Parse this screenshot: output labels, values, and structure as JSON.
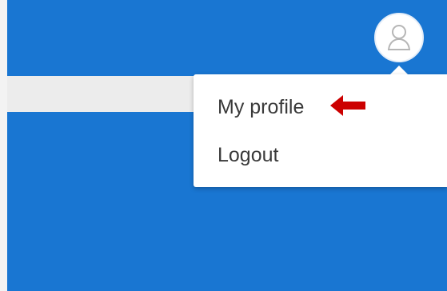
{
  "header": {
    "avatar_icon": "user-avatar-icon"
  },
  "user_menu": {
    "items": [
      {
        "label": "My profile",
        "icon": ""
      },
      {
        "label": "Logout",
        "icon": ""
      }
    ]
  },
  "annotation": {
    "icon": "left-arrow-icon",
    "color": "#cc0000"
  },
  "colors": {
    "primary": "#1976d2",
    "surface": "#ffffff",
    "text": "#3a3a3a",
    "strip": "#ececec"
  }
}
